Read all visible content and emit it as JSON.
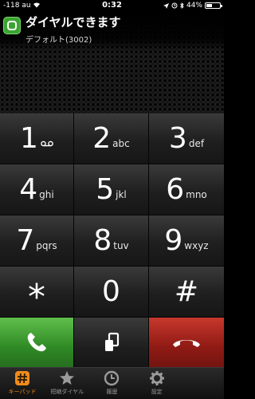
{
  "status_bar": {
    "signal": "-118",
    "carrier": "au",
    "time": "0:32",
    "battery_percent_label": "44%",
    "battery_level": 0.44
  },
  "header": {
    "title": "ダイヤルできます",
    "subtitle": "デフォルト(3002)"
  },
  "keypad": {
    "keys": [
      {
        "digit": "1",
        "letters": ""
      },
      {
        "digit": "2",
        "letters": "abc"
      },
      {
        "digit": "3",
        "letters": "def"
      },
      {
        "digit": "4",
        "letters": "ghi"
      },
      {
        "digit": "5",
        "letters": "jkl"
      },
      {
        "digit": "6",
        "letters": "mno"
      },
      {
        "digit": "7",
        "letters": "pqrs"
      },
      {
        "digit": "8",
        "letters": "tuv"
      },
      {
        "digit": "9",
        "letters": "wxyz"
      },
      {
        "digit": "*",
        "letters": ""
      },
      {
        "digit": "0",
        "letters": ""
      },
      {
        "digit": "#",
        "letters": ""
      }
    ]
  },
  "actions": {
    "call_icon": "phone-icon",
    "transfer_icon": "transfer-icon",
    "hangup_icon": "hangup-icon",
    "call_color": "#3f9f33",
    "hangup_color": "#a8241b"
  },
  "tabs": [
    {
      "label": "キーパッド",
      "icon": "keypad-icon",
      "active": true
    },
    {
      "label": "短縮ダイヤル",
      "icon": "star-icon",
      "active": false
    },
    {
      "label": "履歴",
      "icon": "clock-icon",
      "active": false
    },
    {
      "label": "設定",
      "icon": "gear-icon",
      "active": false
    }
  ],
  "accent_color": "#f08b1a"
}
